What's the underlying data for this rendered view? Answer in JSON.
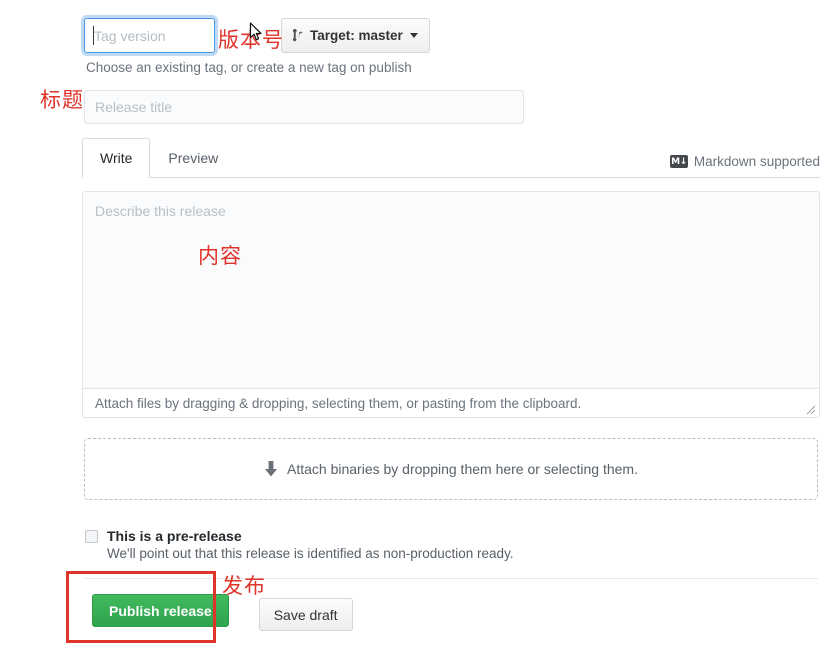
{
  "tag": {
    "placeholder": "Tag version",
    "value": "",
    "help": "Choose an existing tag, or create a new tag on publish"
  },
  "target": {
    "label": "Target: master",
    "icon": "git-branch-icon"
  },
  "title_field": {
    "placeholder": "Release title",
    "value": ""
  },
  "editor": {
    "tabs": [
      {
        "label": "Write",
        "active": true
      },
      {
        "label": "Preview",
        "active": false
      }
    ],
    "markdown_note": "Markdown supported",
    "markdown_icon_text": "M↓",
    "body_placeholder": "Describe this release",
    "body_value": "",
    "attach_note": "Attach files by dragging & dropping, selecting them, or pasting from the clipboard."
  },
  "dropzone": {
    "text": "Attach binaries by dropping them here or selecting them.",
    "icon": "download-arrow-icon"
  },
  "prerelease": {
    "label": "This is a pre-release",
    "description": "We'll point out that this release is identified as non-production ready.",
    "checked": false
  },
  "footer": {
    "publish_label": "Publish release",
    "draft_label": "Save draft"
  },
  "annotations": {
    "version": "版本号",
    "title": "标题",
    "content": "内容",
    "publish": "发布",
    "color": "#e0342a"
  }
}
